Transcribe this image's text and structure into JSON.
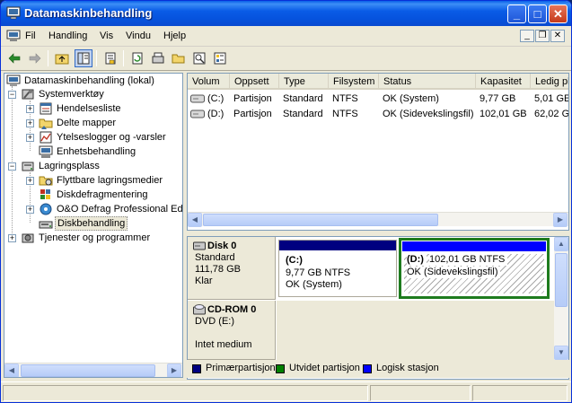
{
  "window": {
    "title": "Datamaskinbehandling"
  },
  "menu": [
    "Fil",
    "Handling",
    "Vis",
    "Vindu",
    "Hjelp"
  ],
  "tree": {
    "root": "Datamaskinbehandling (lokal)",
    "items": [
      {
        "label": "Systemverktøy",
        "icon": "tools-icon"
      },
      {
        "label": "Hendelsesliste",
        "icon": "event-viewer-icon"
      },
      {
        "label": "Delte mapper",
        "icon": "shared-folder-icon"
      },
      {
        "label": "Ytelseslogger og -varsler",
        "icon": "performance-log-icon"
      },
      {
        "label": "Enhetsbehandling",
        "icon": "device-manager-icon"
      },
      {
        "label": "Lagringsplass",
        "icon": "storage-icon"
      },
      {
        "label": "Flyttbare lagringsmedier",
        "icon": "removable-storage-icon"
      },
      {
        "label": "Diskdefragmentering",
        "icon": "defrag-icon"
      },
      {
        "label": "O&O Defrag Professional Edi",
        "icon": "oo-defrag-icon"
      },
      {
        "label": "Diskbehandling",
        "icon": "disk-management-icon"
      },
      {
        "label": "Tjenester og programmer",
        "icon": "services-icon"
      }
    ]
  },
  "volumes": {
    "columns": [
      "Volum",
      "Oppsett",
      "Type",
      "Filsystem",
      "Status",
      "Kapasitet",
      "Ledig pl"
    ],
    "rows": [
      [
        "(C:)",
        "Partisjon",
        "Standard",
        "NTFS",
        "OK (System)",
        "9,77 GB",
        "5,01 GE"
      ],
      [
        "(D:)",
        "Partisjon",
        "Standard",
        "NTFS",
        "OK (Sidevekslingsfil)",
        "102,01 GB",
        "62,02 G"
      ]
    ]
  },
  "disks": [
    {
      "name": "Disk 0",
      "type": "Standard",
      "size": "111,78 GB",
      "state": "Klar",
      "partitions": [
        {
          "name": "(C:)",
          "size": "9,77 GB NTFS",
          "status": "OK (System)"
        },
        {
          "name": "(D:)",
          "size": "102,01 GB NTFS",
          "status": "OK (Sidevekslingsfil)"
        }
      ]
    },
    {
      "name": "CD-ROM 0",
      "type": "DVD (E:)",
      "state": "Intet medium"
    }
  ],
  "legend": [
    {
      "label": "Primærpartisjon",
      "color": "#000080"
    },
    {
      "label": "Utvidet partisjon",
      "color": "#008000"
    },
    {
      "label": "Logisk stasjon",
      "color": "#0000FF"
    }
  ],
  "colors": {
    "primary": "#000080",
    "extended": "#008000",
    "logical": "#0000FF",
    "selection_border": "#1E7B1E"
  }
}
